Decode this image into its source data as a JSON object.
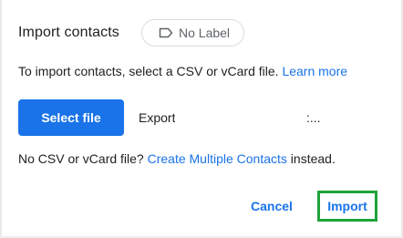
{
  "dialog": {
    "title": "Import contacts",
    "label_chip": {
      "label": "No Label",
      "icon": "label-outline-icon"
    },
    "instruction_text": "To import contacts, select a CSV or vCard file.",
    "learn_more_link": "Learn more",
    "select_file_button": "Select file",
    "file_name_prefix": "Export",
    "file_name_suffix": ":...",
    "alt_prefix": "No CSV or vCard file?",
    "create_multiple_link": "Create Multiple Contacts",
    "alt_suffix": "instead.",
    "cancel_button": "Cancel",
    "import_button": "Import"
  },
  "colors": {
    "accent": "#1a73e8",
    "text": "#202124",
    "muted": "#5f6368",
    "highlight": "#1fa33a"
  }
}
